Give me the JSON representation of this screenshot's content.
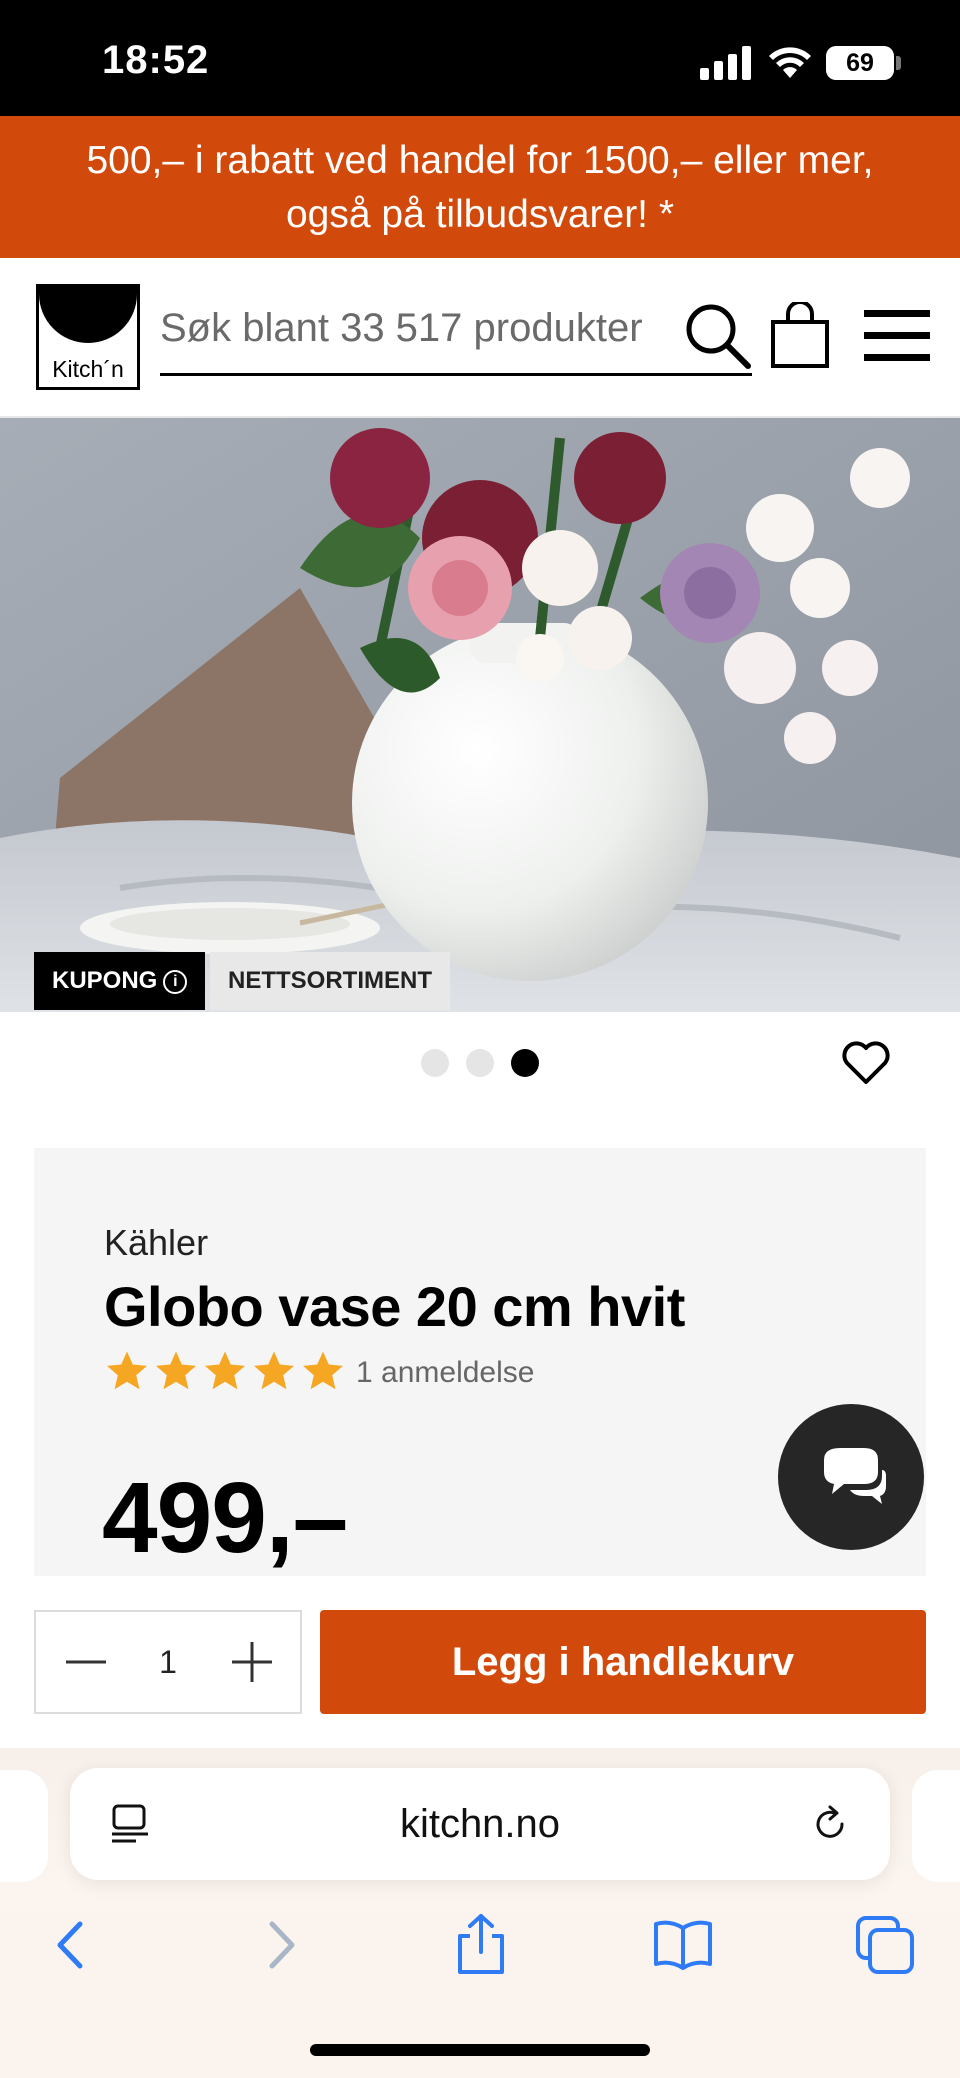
{
  "status_bar": {
    "time": "18:52",
    "battery": "69"
  },
  "promo_banner": {
    "line1": "500,– i rabatt ved handel for 1500,– eller mer,",
    "line2": "også på tilbudsvarer! *"
  },
  "header": {
    "logo_text": "Kitch´n",
    "search_placeholder": "Søk blant 33 517 produkter",
    "icons": {
      "search": "search-icon",
      "cart": "shopping-bag-icon",
      "menu": "hamburger-menu-icon"
    }
  },
  "hero": {
    "badges": {
      "kupong": "KUPONG",
      "kupong_info": "i",
      "nettsortiment": "NETTSORTIMENT"
    },
    "carousel": {
      "count": 3,
      "active_index": 2
    }
  },
  "product": {
    "brand": "Kähler",
    "title": "Globo vase 20 cm hvit",
    "rating": 5,
    "rating_max": 5,
    "reviews": "1 anmeldelse",
    "price": "499,–",
    "quantity": "1",
    "add_to_cart": "Legg i handlekurv"
  },
  "browser": {
    "url": "kitchn.no",
    "icons": {
      "reader": "reader-mode-icon",
      "reload": "reload-icon",
      "back": "back-chevron-icon",
      "forward": "forward-chevron-icon",
      "share": "share-icon",
      "bookmarks": "bookmarks-icon",
      "tabs": "tabs-icon"
    }
  },
  "colors": {
    "brand_orange": "#d24a0b",
    "star": "#f5a623",
    "ios_blue": "#2f7bf6",
    "dark": "#262626"
  }
}
